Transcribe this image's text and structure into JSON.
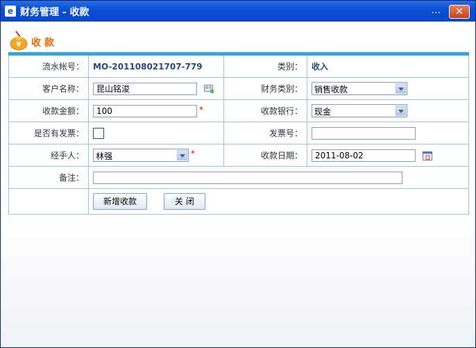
{
  "window": {
    "title": "财务管理 - 收款",
    "dots": "...",
    "close_glyph": "✕"
  },
  "page": {
    "title": "收 款"
  },
  "form": {
    "serial_label": "流水帐号：",
    "serial_value": "MO-201108021707-779",
    "category_label": "类别：",
    "category_value": "收入",
    "customer_label": "客户名称：",
    "customer_value": "昆山铭浚",
    "finance_type_label": "财务类别：",
    "finance_type_value": "销售收款",
    "amount_label": "收款金额：",
    "amount_value": "100",
    "bank_label": "收款银行：",
    "bank_value": "现金",
    "invoice_flag_label": "是否有发票：",
    "invoice_no_label": "发票号：",
    "invoice_no_value": "",
    "handler_label": "经手人：",
    "handler_value": "林强",
    "date_label": "收款日期：",
    "date_value": "2011-08-02",
    "remark_label": "备注：",
    "remark_value": "",
    "required_mark": "*"
  },
  "buttons": {
    "add_label": "新增收款",
    "close_label": "关 闭"
  },
  "colors": {
    "titlebar": "#0a4fd8",
    "accent_orange": "#e66a00",
    "table_border": "#9cc3e6",
    "table_top_bar": "#35a7dc"
  }
}
